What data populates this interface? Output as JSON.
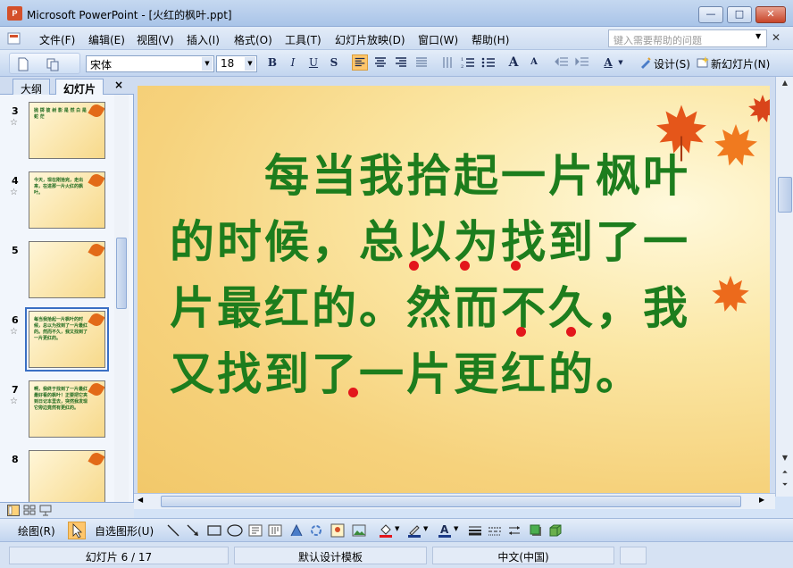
{
  "window": {
    "title": "Microsoft PowerPoint - [火红的枫叶.ppt]",
    "app_icon_letter": "P",
    "minimize": "—",
    "maximize": "□",
    "close": "✕"
  },
  "menu": {
    "items": [
      "文件(F)",
      "编辑(E)",
      "视图(V)",
      "插入(I)",
      "格式(O)",
      "工具(T)",
      "幻灯片放映(D)",
      "窗口(W)",
      "帮助(H)"
    ],
    "help_placeholder": "键入需要帮助的问题",
    "help_arrow": "▼",
    "close_doc": "✕"
  },
  "toolbar": {
    "font_name": "宋体",
    "font_size": "18",
    "bold": "B",
    "italic": "I",
    "underline": "U",
    "shadow": "S",
    "grow_font": "A",
    "shrink_font": "A",
    "font_color": "A",
    "design_label": "设计(S)",
    "new_slide_label": "新幻灯片(N)"
  },
  "left_panel": {
    "tab_outline": "大纲",
    "tab_slides": "幻灯片",
    "close": "×",
    "thumbnails": [
      {
        "num": "3",
        "text": "抛 掷 彼 树 影 是 然 白 是 蛇 茫 ",
        "selected": false,
        "star": true
      },
      {
        "num": "4",
        "text": "今天，现在刚拾完，走出来，在进那一片火红的枫叶。",
        "selected": false,
        "star": true
      },
      {
        "num": "5",
        "text": "",
        "selected": false,
        "star": false
      },
      {
        "num": "6",
        "text": "每当我拾起一片枫叶的时候，总以为找到了一片最红的。然而不久，我又找到了一片更红的。",
        "selected": true,
        "star": true
      },
      {
        "num": "7",
        "text": "啊，我终于找到了一片最红最好看的枫叶！正要把它夹到日记本里去，突然我发现它旁边竟然有更红的。",
        "selected": false,
        "star": true
      },
      {
        "num": "8",
        "text": "",
        "selected": false,
        "star": false
      }
    ]
  },
  "slide": {
    "text": "　　每当我拾起一片枫叶的时候，总以为找到了一片最红的。然而不久，我又找到了一片更红的。",
    "text_color": "#1d7d1d",
    "dot_color": "#e3161b"
  },
  "drawing_toolbar": {
    "draw_label": "绘图(R)",
    "autoshape_label": "自选图形(U)"
  },
  "status": {
    "slide_info": "幻灯片 6 / 17",
    "template": "默认设计模板",
    "language": "中文(中国)"
  }
}
